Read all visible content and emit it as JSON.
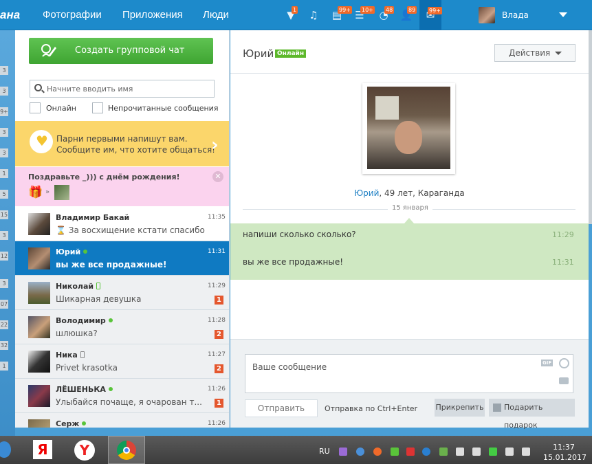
{
  "top": {
    "logo": "ана",
    "nav": [
      "Фотографии",
      "Приложения",
      "Люди"
    ],
    "badges": {
      "guests": "1",
      "events": "99+",
      "lists": "10+",
      "notifications": "48",
      "friends": "89",
      "messages": "99+"
    },
    "user_name": "Влада"
  },
  "left_strip": [
    "3",
    "3",
    "9+",
    "3",
    "3",
    "3",
    "1",
    "5",
    "15",
    "3",
    "12",
    "3",
    "07",
    "22",
    "32",
    "1"
  ],
  "sidebar": {
    "create_button": "Создать групповой чат",
    "search_placeholder": "Начните вводить имя",
    "filter_online": "Онлайн",
    "filter_unread": "Непрочитанные сообщения",
    "promo_line1": "Парни первыми напишут вам.",
    "promo_line2": "Сообщите им, что хотите общаться!",
    "birthday_title": "Поздравьте _))) с днём рождения!",
    "chats": [
      {
        "name": "Владимир Бакай",
        "time": "11:35",
        "message": "За восхищение кстати спасибо",
        "status": "none",
        "unread": ""
      },
      {
        "name": "Юрий",
        "time": "11:31",
        "message": "вы же все продажные!",
        "status": "online",
        "unread": ""
      },
      {
        "name": "Николай",
        "time": "11:29",
        "message": "Шикарная девушка",
        "status": "mobile",
        "unread": "1"
      },
      {
        "name": "Володимир",
        "time": "11:28",
        "message": "шлюшка?",
        "status": "online",
        "unread": "2"
      },
      {
        "name": "Ника",
        "time": "11:27",
        "message": "Privet krasotka",
        "status": "mobile-offline",
        "unread": "2"
      },
      {
        "name": "ЛЁШЕНЬКА",
        "time": "11:26",
        "message": "Улыбайся почаще, я очарован т...",
        "status": "online",
        "unread": "1"
      },
      {
        "name": "Серж",
        "time": "11:26",
        "message": "",
        "status": "online",
        "unread": ""
      }
    ]
  },
  "conversation": {
    "name": "Юрий",
    "status": "Онлайн",
    "actions": "Действия",
    "profile_name": "Юрий",
    "profile_info": ", 49 лет, Караганда",
    "date": "15 января",
    "messages": [
      {
        "text": "напиши сколько сколько?",
        "time": "11:29"
      },
      {
        "text": "вы же все продажные!",
        "time": "11:31"
      }
    ],
    "input_placeholder": "Ваше сообщение",
    "gif_label": "GIF",
    "send": "Отправить",
    "hint": "Отправка по Ctrl+Enter",
    "attach": "Прикрепить",
    "gift": "Подарить подарок"
  },
  "taskbar": {
    "lang": "RU",
    "time": "11:37",
    "date": "15.01.2017"
  }
}
